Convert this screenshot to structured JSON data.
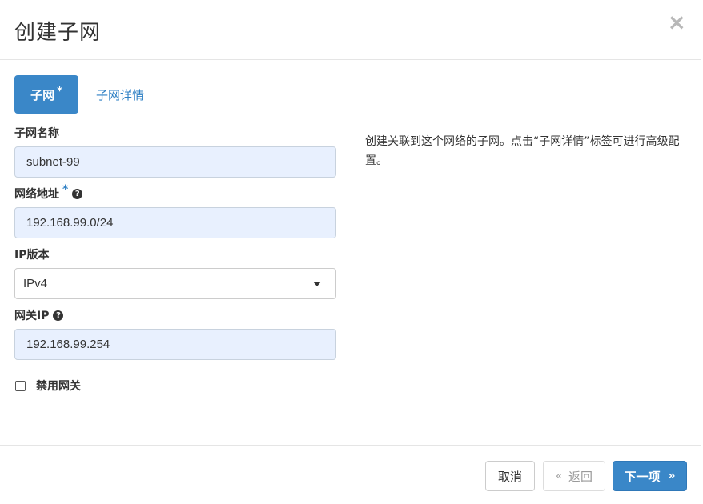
{
  "dialog": {
    "title": "创建子网",
    "close_icon": "×"
  },
  "tabs": [
    {
      "label": "子网",
      "required_marker": "*",
      "active": true
    },
    {
      "label": "子网详情",
      "active": false
    }
  ],
  "form": {
    "subnet_name": {
      "label": "子网名称",
      "value": "subnet-99"
    },
    "network_address": {
      "label": "网络地址",
      "required_marker": "*",
      "help_icon": "?",
      "value": "192.168.99.0/24"
    },
    "ip_version": {
      "label": "IP版本",
      "selected": "IPv4"
    },
    "gateway_ip": {
      "label": "网关IP",
      "help_icon": "?",
      "value": "192.168.99.254"
    },
    "disable_gateway": {
      "label": "禁用网关",
      "checked": false
    }
  },
  "help_text": "创建关联到这个网络的子网。点击“子网详情”标签可进行高级配置。",
  "footer": {
    "cancel_label": "取消",
    "back_chevron": "«",
    "back_label": "返回",
    "next_label": "下一项",
    "next_chevron": "»"
  },
  "colors": {
    "primary": "#3a87c8",
    "link": "#2d7fc4",
    "input_autofill_bg": "#e8f0fe"
  }
}
